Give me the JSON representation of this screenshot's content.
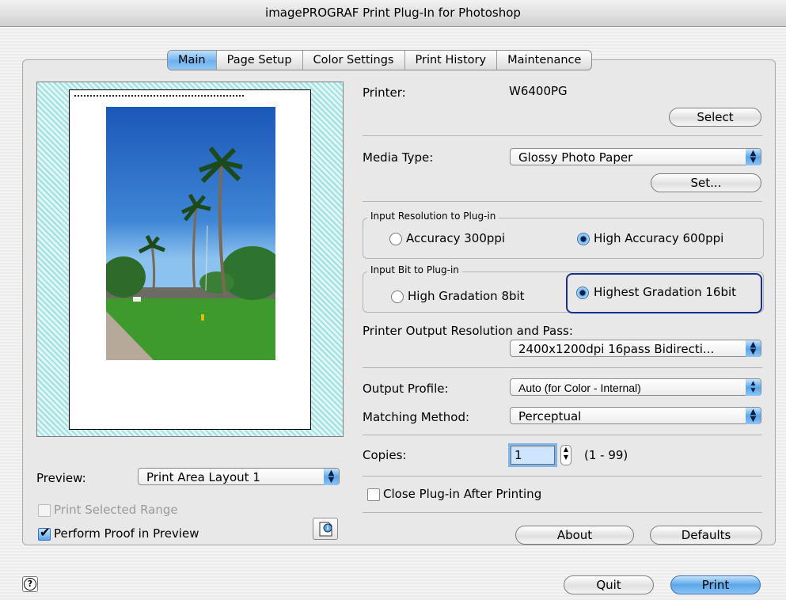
{
  "window": {
    "title": "imagePROGRAF Print Plug-In for Photoshop"
  },
  "tabs": [
    {
      "label": "Main",
      "active": true
    },
    {
      "label": "Page Setup",
      "active": false
    },
    {
      "label": "Color Settings",
      "active": false
    },
    {
      "label": "Print History",
      "active": false
    },
    {
      "label": "Maintenance",
      "active": false
    }
  ],
  "printer": {
    "label": "Printer:",
    "value": "W6400PG",
    "select_label": "Select"
  },
  "media": {
    "label": "Media Type:",
    "value": "Glossy Photo Paper",
    "set_label": "Set..."
  },
  "input_resolution": {
    "title": "Input Resolution to Plug-in",
    "options": [
      {
        "label": "Accuracy 300ppi",
        "selected": false
      },
      {
        "label": "High Accuracy 600ppi",
        "selected": true
      }
    ]
  },
  "input_bit": {
    "title": "Input Bit to Plug-in",
    "options": [
      {
        "label": "High Gradation 8bit",
        "selected": false
      },
      {
        "label": "Highest Gradation 16bit",
        "selected": true
      }
    ]
  },
  "output_resolution": {
    "label": "Printer Output Resolution and Pass:",
    "value": "2400x1200dpi 16pass Bidirecti..."
  },
  "output_profile": {
    "label": "Output Profile:",
    "value": "Auto (for Color - Internal)"
  },
  "matching": {
    "label": "Matching Method:",
    "value": "Perceptual"
  },
  "copies": {
    "label": "Copies:",
    "value": "1",
    "range": "(1 - 99)"
  },
  "close_after": {
    "label": "Close Plug-in After Printing",
    "checked": false
  },
  "about_label": "About",
  "defaults_label": "Defaults",
  "preview": {
    "label": "Preview:",
    "value": "Print Area Layout 1"
  },
  "print_selected": {
    "label": "Print Selected Range",
    "checked": false,
    "enabled": false
  },
  "perform_proof": {
    "label": "Perform Proof in Preview",
    "checked": true
  },
  "quit_label": "Quit",
  "print_label": "Print",
  "help_glyph": "?",
  "colors": {
    "accent": "#5aa6ea",
    "focus": "#1b2f8e",
    "preview_hatch": "#9fe0df"
  }
}
